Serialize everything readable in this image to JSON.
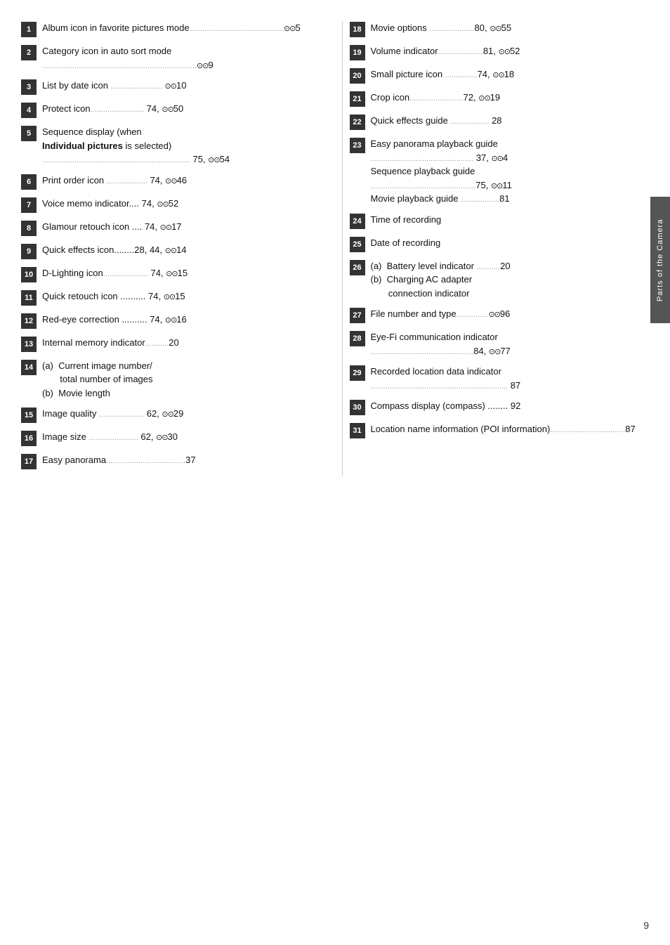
{
  "page": {
    "number": "9",
    "side_label": "Parts of the Camera"
  },
  "left_items": [
    {
      "num": "1",
      "text": "Album icon in favorite pictures mode",
      "suffix": "⊙⊙5",
      "dots": true
    },
    {
      "num": "2",
      "text": "Category icon in auto sort mode",
      "suffix": "⊙⊙9",
      "dots": true
    },
    {
      "num": "3",
      "text": "List by date icon",
      "suffix": "⊙⊙10",
      "dots": true
    },
    {
      "num": "4",
      "text": "Protect icon",
      "suffix": "74, ⊙⊙50",
      "dots": true
    },
    {
      "num": "5",
      "text": "Sequence display (when Individual pictures is selected)",
      "suffix": "75, ⊙⊙54",
      "bold_phrase": "Individual pictures",
      "dots": true
    },
    {
      "num": "6",
      "text": "Print order icon",
      "suffix": "74, ⊙⊙46",
      "dots": true
    },
    {
      "num": "7",
      "text": "Voice memo indicator",
      "suffix": "74, ⊙⊙52",
      "dots": false
    },
    {
      "num": "8",
      "text": "Glamour retouch icon",
      "suffix": "74, ⊙⊙17",
      "dots": false
    },
    {
      "num": "9",
      "text": "Quick effects icon",
      "suffix": "28, 44, ⊙⊙14",
      "dots": false
    },
    {
      "num": "10",
      "text": "D-Lighting icon",
      "suffix": "74, ⊙⊙15",
      "dots": true
    },
    {
      "num": "11",
      "text": "Quick retouch icon",
      "suffix": "74, ⊙⊙15",
      "dots": false
    },
    {
      "num": "12",
      "text": "Red-eye correction",
      "suffix": "74, ⊙⊙16",
      "dots": false
    },
    {
      "num": "13",
      "text": "Internal memory indicator",
      "suffix": "20",
      "dots": true
    },
    {
      "num": "14",
      "text": "(a) Current image number/ total number of images\n(b) Movie length",
      "suffix": "",
      "dots": false
    },
    {
      "num": "15",
      "text": "Image quality",
      "suffix": "62, ⊙⊙29",
      "dots": true
    },
    {
      "num": "16",
      "text": "Image size",
      "suffix": "62, ⊙⊙30",
      "dots": true
    },
    {
      "num": "17",
      "text": "Easy panorama",
      "suffix": "37",
      "dots": true
    }
  ],
  "right_items": [
    {
      "num": "18",
      "text": "Movie options",
      "suffix": "80, ⊙⊙55",
      "dots": true
    },
    {
      "num": "19",
      "text": "Volume indicator",
      "suffix": "81, ⊙⊙52",
      "dots": true
    },
    {
      "num": "20",
      "text": "Small picture icon",
      "suffix": "74, ⊙⊙18",
      "dots": true
    },
    {
      "num": "21",
      "text": "Crop icon",
      "suffix": "72, ⊙⊙19",
      "dots": true
    },
    {
      "num": "22",
      "text": "Quick effects guide",
      "suffix": "28",
      "dots": true
    },
    {
      "num": "23",
      "text": "Easy panorama playback guide\n37, ⊙⊙4\nSequence playback guide\n75, ⊙⊙11\nMovie playback guide 81",
      "suffix": "",
      "dots": false,
      "multipart": true
    },
    {
      "num": "24",
      "text": "Time of recording",
      "suffix": "",
      "dots": false
    },
    {
      "num": "25",
      "text": "Date of recording",
      "suffix": "",
      "dots": false
    },
    {
      "num": "26",
      "text": "(a) Battery level indicator 20\n(b) Charging AC adapter\n     connection indicator",
      "suffix": "",
      "dots": false,
      "multipart": true
    },
    {
      "num": "27",
      "text": "File number and type",
      "suffix": "⊙⊙96",
      "dots": true
    },
    {
      "num": "28",
      "text": "Eye-Fi communication indicator",
      "suffix": "84, ⊙⊙77",
      "dots": true
    },
    {
      "num": "29",
      "text": "Recorded location data indicator",
      "suffix": "87",
      "dots": true
    },
    {
      "num": "30",
      "text": "Compass display (compass)",
      "suffix": "92",
      "dots": false
    },
    {
      "num": "31",
      "text": "Location name information (POI information)",
      "suffix": "87",
      "dots": true
    }
  ]
}
